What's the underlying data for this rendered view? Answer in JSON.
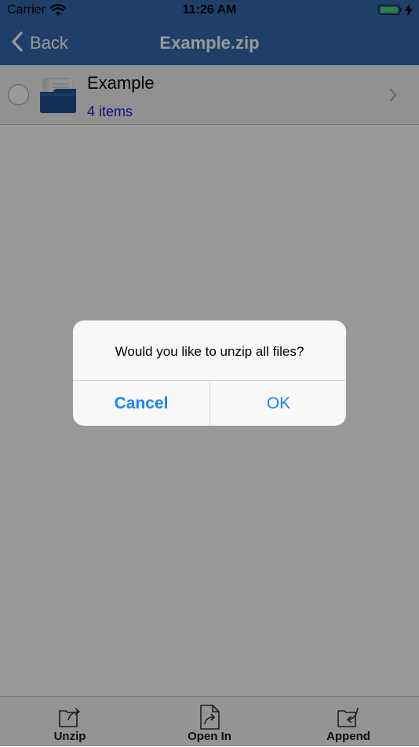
{
  "status_bar": {
    "carrier": "Carrier",
    "time": "11:26 AM",
    "battery_level": 1.0
  },
  "nav": {
    "back_label": "Back",
    "title": "Example.zip"
  },
  "list": {
    "items": [
      {
        "title": "Example",
        "subtitle": "4 items",
        "icon": "folder-icon"
      }
    ]
  },
  "alert": {
    "message": "Would you like to unzip all files?",
    "cancel_label": "Cancel",
    "ok_label": "OK"
  },
  "toolbar": {
    "unzip_label": "Unzip",
    "open_in_label": "Open In",
    "append_label": "Append"
  },
  "colors": {
    "nav_background": "#3569ad",
    "link": "#1a84ff",
    "subtitle": "#1a1adc",
    "battery": "#4cd964"
  }
}
